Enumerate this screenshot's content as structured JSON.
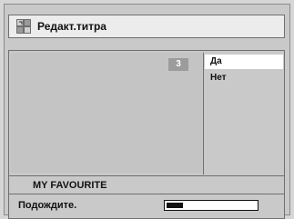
{
  "window": {
    "title": "Редакт.титра",
    "icon": "video-title-edit-icon"
  },
  "preview": {
    "badge": "3"
  },
  "options": [
    {
      "label": "Да",
      "selected": true
    },
    {
      "label": "Нет",
      "selected": false
    }
  ],
  "subtitle_text": "MY FAVOURITE",
  "status": {
    "text": "Подождите.",
    "progress_fraction": 0.18
  },
  "colors": {
    "background": "#d6d6d6",
    "panel": "#c9c9c9",
    "selected_option": "#ffffff",
    "badge": "#9c9c9c"
  }
}
